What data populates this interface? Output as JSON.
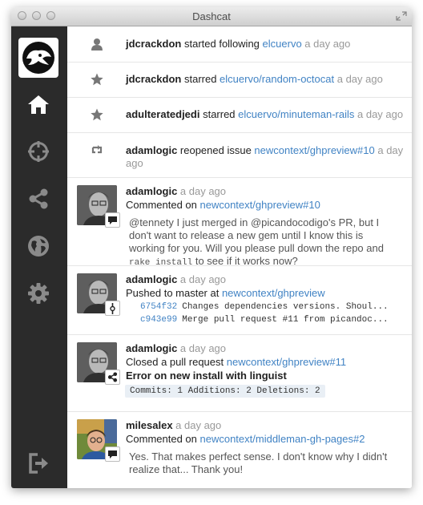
{
  "window": {
    "title": "Dashcat"
  },
  "sidebar": {
    "logo": "octocat-logo",
    "items": [
      {
        "name": "home",
        "icon": "home-icon"
      },
      {
        "name": "crosshair",
        "icon": "crosshair-icon"
      },
      {
        "name": "share",
        "icon": "share-icon"
      },
      {
        "name": "globe",
        "icon": "globe-icon"
      },
      {
        "name": "settings",
        "icon": "gear-icon"
      },
      {
        "name": "logout",
        "icon": "sign-out-icon"
      }
    ]
  },
  "colors": {
    "link": "#4183c4",
    "sidebar": "#2b2b2b",
    "muted": "#999999"
  },
  "events": [
    {
      "actor": "jdcrackdon",
      "action": " started following ",
      "target": "elcuervo",
      "time": " a day ago",
      "icon": "user-icon"
    },
    {
      "actor": "jdcrackdon",
      "action": " starred ",
      "target": "elcuervo/random-octocat",
      "time": " a day ago",
      "icon": "star-icon"
    },
    {
      "actor": "adulteratedjedi",
      "action": " starred ",
      "target": "elcuervo/minuteman-rails",
      "time": " a day ago",
      "icon": "star-icon"
    },
    {
      "actor": "adamlogic",
      "action": " reopened issue ",
      "target": "newcontext/ghpreview#10",
      "time": " a day",
      "time2": "ago",
      "icon": "issue-reopened-icon"
    },
    {
      "actor": "adamlogic",
      "time": " a day ago",
      "action": "Commented on ",
      "target": "newcontext/ghpreview#10",
      "comment_a": "@tennety I just merged in @picandocodigo's PR, but I don't want to release a new gem until I know this is working for you. Will you please pull down the repo and ",
      "comment_code": "rake install",
      "comment_b": " to see if it works now?",
      "badge": "comment-icon"
    },
    {
      "actor": "adamlogic",
      "time": " a day ago",
      "action": "Pushed to master at ",
      "target": "newcontext/ghpreview",
      "commits": [
        {
          "sha": "6754f32",
          "message": "Changes dependencies versions. Shoul..."
        },
        {
          "sha": "c943e99",
          "message": "Merge pull request #11 from picandoc..."
        }
      ],
      "badge": "commit-icon"
    },
    {
      "actor": "adamlogic",
      "time": " a day ago",
      "action": "Closed a pull request ",
      "target": "newcontext/ghpreview#11",
      "pr_title": "Error on new install with linguist",
      "stats": "Commits: 1 Additions: 2 Deletions: 2",
      "badge": "share-icon"
    },
    {
      "actor": "milesalex",
      "time": " a day ago",
      "action": "Commented on ",
      "target": "newcontext/middleman-gh-pages#2",
      "comment": "Yes. That makes perfect sense. I don't know why I didn't realize that... Thank you!",
      "badge": "comment-icon"
    }
  ]
}
